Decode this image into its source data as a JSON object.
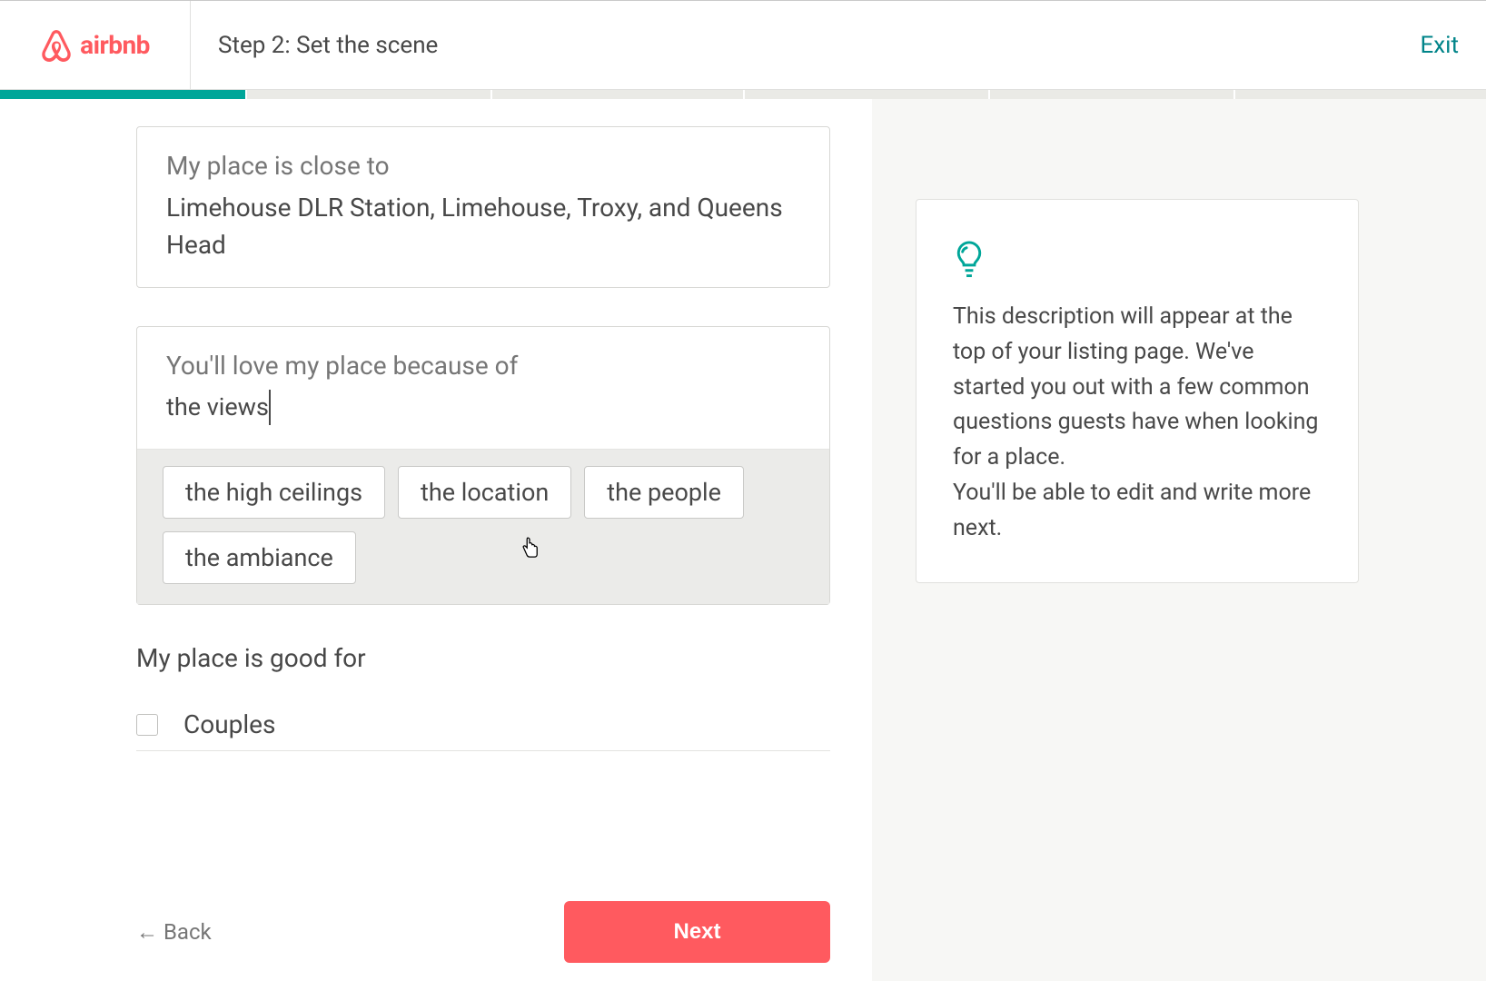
{
  "header": {
    "brand": "airbnb",
    "step_label": "Step 2: Set the scene",
    "exit_label": "Exit"
  },
  "progress": {
    "fill_percent": 16.5
  },
  "close_to": {
    "label": "My place is close to",
    "value": "Limehouse DLR Station, Limehouse, Troxy, and Queens Head"
  },
  "love_because": {
    "label": "You'll love my place because of",
    "value": "the views",
    "suggestions": [
      "the high ceilings",
      "the location",
      "the people",
      "the ambiance"
    ]
  },
  "good_for": {
    "heading": "My place is good for",
    "options": [
      {
        "label": "Couples",
        "checked": false
      }
    ]
  },
  "footer": {
    "back_label": "← Back",
    "next_label": "Next"
  },
  "tip": {
    "line1": "This description will appear at the top of your listing page. We've started you out with a few common questions guests have when looking for a place.",
    "line2": "You'll be able to edit and write more next."
  }
}
